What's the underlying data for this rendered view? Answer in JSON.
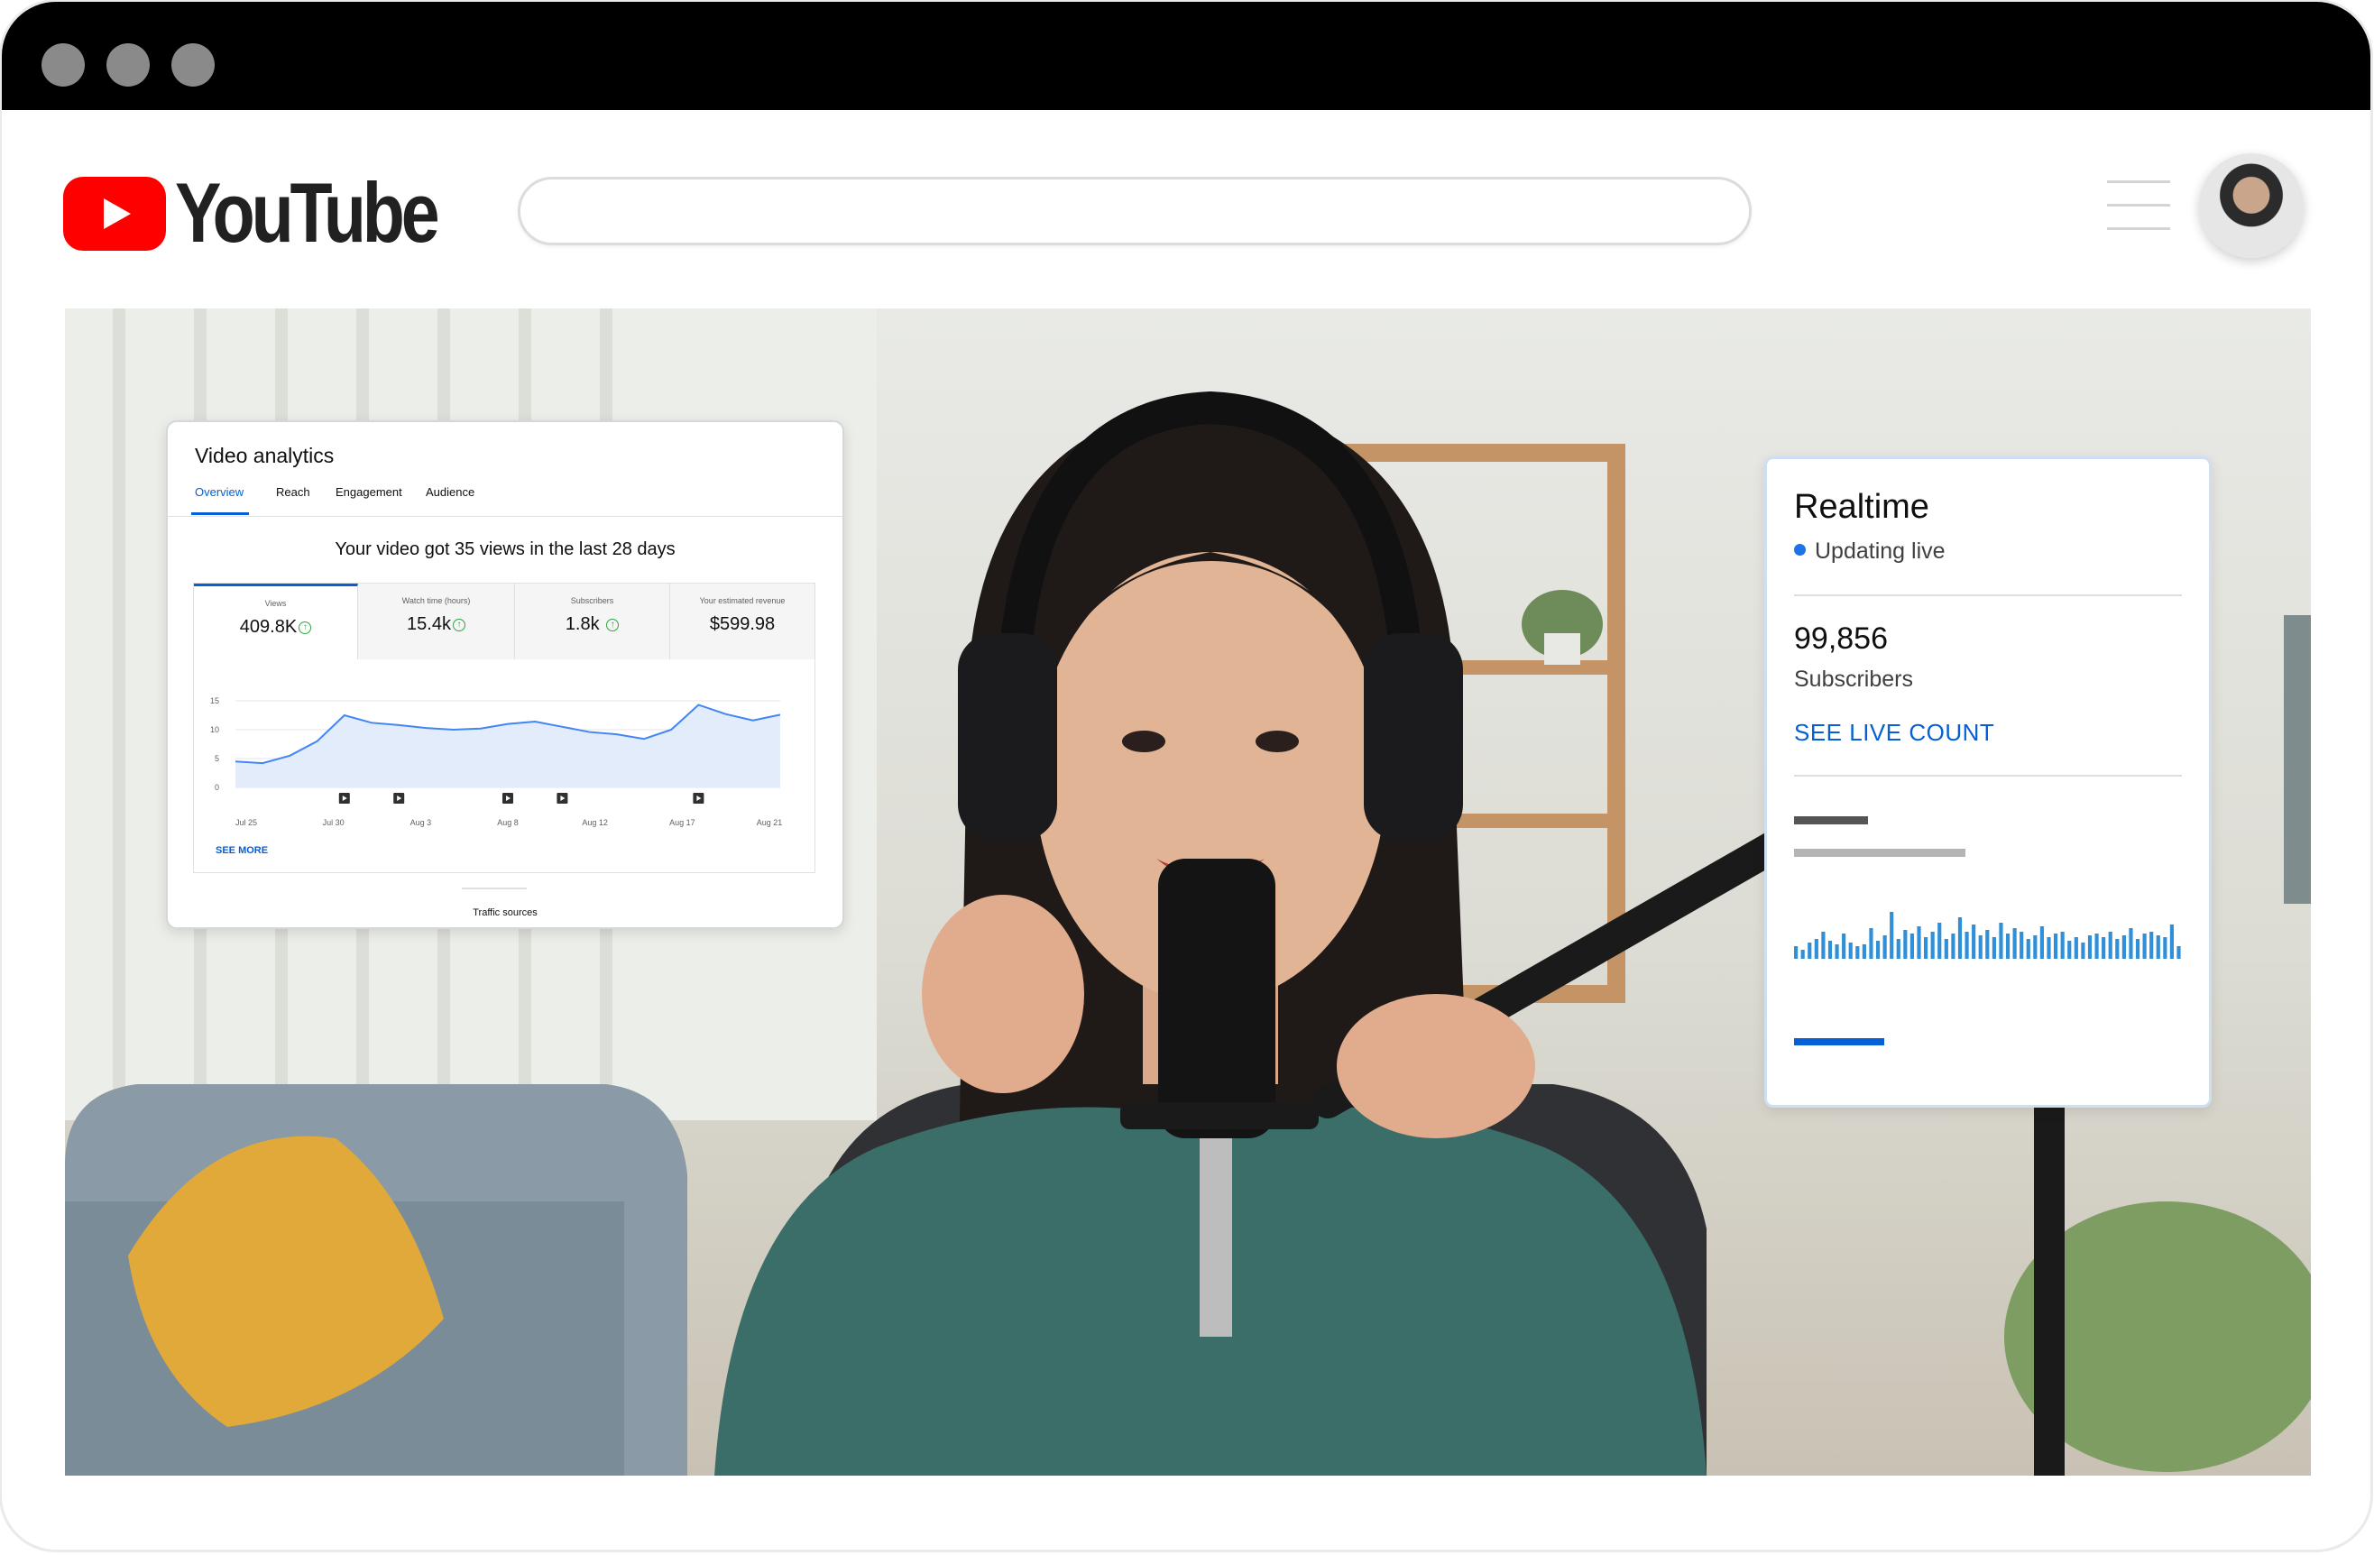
{
  "window": {
    "controls": [
      "close",
      "minimize",
      "maximize"
    ]
  },
  "header": {
    "logo_text": "YouTube",
    "search": {
      "value": "",
      "placeholder": ""
    },
    "icons": [
      "youtube-play-icon",
      "menu-icon",
      "avatar"
    ]
  },
  "analytics": {
    "title": "Video analytics",
    "tabs": [
      {
        "label": "Overview",
        "active": true
      },
      {
        "label": "Reach",
        "active": false
      },
      {
        "label": "Engagement",
        "active": false
      },
      {
        "label": "Audience",
        "active": false
      }
    ],
    "headline": "Your video got 35 views in the last 28 days",
    "metrics": [
      {
        "label": "Views",
        "value": "409.8K",
        "trend": "up"
      },
      {
        "label": "Watch time (hours)",
        "value": "15.4k",
        "trend": "up"
      },
      {
        "label": "Subscribers",
        "value": "1.8k",
        "trend": "up"
      },
      {
        "label": "Your estimated revenue",
        "value": "$599.98",
        "trend": ""
      }
    ],
    "see_more": "SEE MORE",
    "traffic_sources": "Traffic sources"
  },
  "chart_data": {
    "type": "area",
    "title": "",
    "xlabel": "",
    "ylabel": "",
    "ylim": [
      0,
      15
    ],
    "yticks": [
      "0",
      "5",
      "10",
      "15"
    ],
    "xticks": [
      "Jul 25",
      "Jul 30",
      "Aug 3",
      "Aug 8",
      "Aug 12",
      "Aug 17",
      "Aug 21"
    ],
    "x": [
      0,
      1,
      2,
      3,
      4,
      5,
      6,
      7,
      8,
      9,
      10,
      11,
      12,
      13,
      14,
      15,
      16,
      17,
      18,
      19,
      20,
      21,
      22,
      23,
      24,
      25,
      26,
      27
    ],
    "values": [
      4.5,
      4.2,
      5.5,
      8,
      12.5,
      11.2,
      10.8,
      10.3,
      10,
      10.2,
      11,
      11.4,
      10.5,
      9.6,
      9.2,
      8.4,
      10,
      14.3,
      12.7,
      11.6,
      12.6
    ],
    "video_markers": [
      4,
      6,
      10,
      12,
      17
    ],
    "grid": true,
    "legend": "none",
    "colors": {
      "line": "#4285f4",
      "fill": "#e3ecfb",
      "grid": "#e6e6e6"
    }
  },
  "realtime": {
    "title": "Realtime",
    "status": "Updating live",
    "count": "99,856",
    "count_label": "Subscribers",
    "link": "SEE LIVE COUNT",
    "accent": "#065fd4",
    "sparkline": [
      14,
      10,
      18,
      22,
      30,
      20,
      16,
      28,
      18,
      14,
      16,
      34,
      20,
      26,
      52,
      22,
      32,
      28,
      36,
      24,
      30,
      40,
      22,
      28,
      46,
      30,
      38,
      26,
      32,
      24,
      40,
      28,
      34,
      30,
      22,
      26,
      36,
      24,
      28,
      30,
      20,
      24,
      18,
      26,
      28,
      24,
      30,
      22,
      26,
      34,
      22,
      28,
      30,
      26,
      24,
      38,
      14
    ]
  }
}
